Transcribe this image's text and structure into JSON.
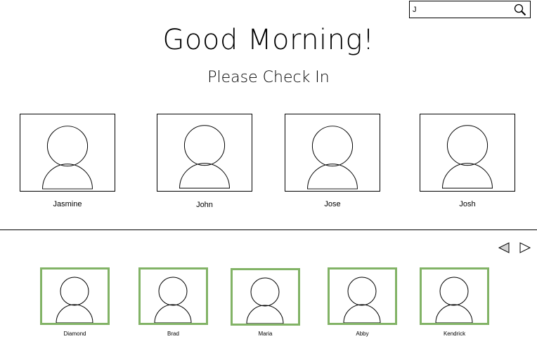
{
  "search": {
    "value": "J",
    "icon": "search-icon"
  },
  "greeting": "Good Morning!",
  "subtitle": "Please Check In",
  "results": [
    {
      "name": "Jasmine"
    },
    {
      "name": "John"
    },
    {
      "name": "Jose"
    },
    {
      "name": "Josh"
    }
  ],
  "carousel": {
    "prev_icon": "chevron-left-icon",
    "next_icon": "chevron-right-icon",
    "accent_color": "#82b366",
    "checked_in": [
      {
        "name": "Diamond"
      },
      {
        "name": "Brad"
      },
      {
        "name": "Maria"
      },
      {
        "name": "Abby"
      },
      {
        "name": "Kendrick"
      }
    ]
  }
}
